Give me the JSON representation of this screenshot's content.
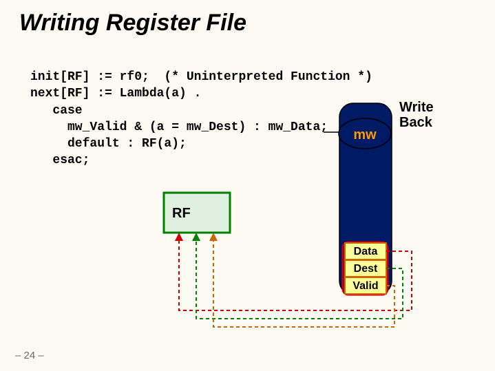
{
  "title": "Writing Register File",
  "code": {
    "l1": "init[RF] := rf0;  (* Uninterpreted Function *)",
    "l2": "next[RF] := Lambda(a) .",
    "l3": "   case",
    "l4": "     mw_Valid & (a = mw_Dest) : mw_Data;",
    "l5": "     default : RF(a);",
    "l6": "   esac;"
  },
  "labels": {
    "wb1": "Write",
    "wb2": "Back",
    "mw": "mw",
    "rf": "RF",
    "data": "Data",
    "dest": "Dest",
    "valid": "Valid"
  },
  "pagenum": "– 24 –"
}
